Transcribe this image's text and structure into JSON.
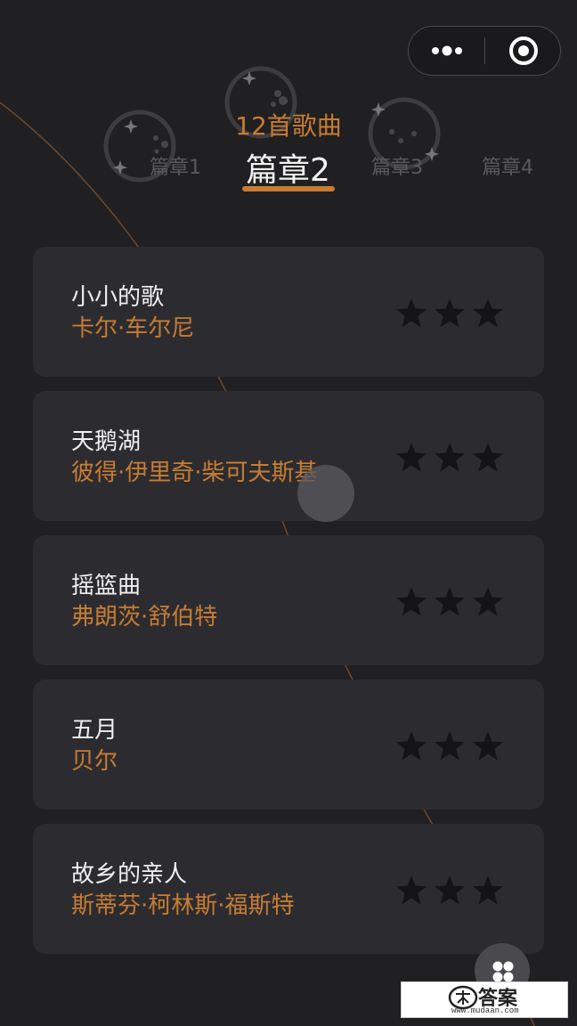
{
  "capsule": {
    "more_icon": "more-dots-icon",
    "close_icon": "target-circle-icon"
  },
  "chapters": {
    "song_count": "12首歌曲",
    "tabs": [
      {
        "label": "篇章1"
      },
      {
        "label": "篇章2",
        "active": true
      },
      {
        "label": "篇章3"
      },
      {
        "label": "篇章4"
      }
    ],
    "accent_color": "#c77c33"
  },
  "songs": [
    {
      "title": "小小的歌",
      "composer": "卡尔·车尔尼",
      "stars_earned": 0,
      "stars_total": 3
    },
    {
      "title": "天鹅湖",
      "composer": "彼得·伊里奇·柴可夫斯基",
      "stars_earned": 0,
      "stars_total": 3
    },
    {
      "title": "摇篮曲",
      "composer": "弗朗茨·舒伯特",
      "stars_earned": 0,
      "stars_total": 3
    },
    {
      "title": "五月",
      "composer": "贝尔",
      "stars_earned": 0,
      "stars_total": 3
    },
    {
      "title": "故乡的亲人",
      "composer": "斯蒂芬·柯林斯·福斯特",
      "stars_earned": 0,
      "stars_total": 3
    }
  ],
  "floating_button": {
    "icon": "four-dots-icon"
  },
  "watermark": {
    "text": "答案",
    "url": "www.mudaan.com",
    "icon": "watermark-logo-icon"
  }
}
